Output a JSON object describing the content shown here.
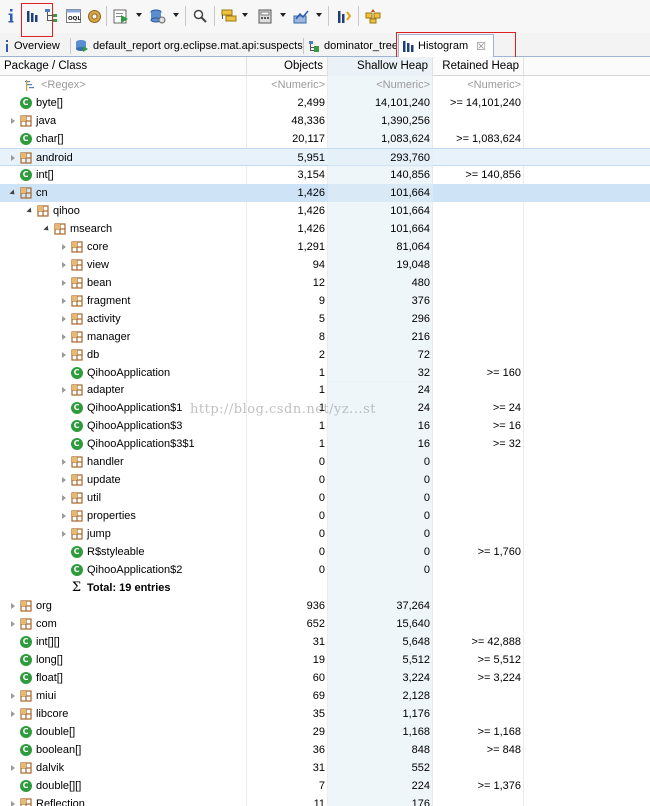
{
  "toolbar": {
    "icons": [
      "info-icon",
      "histogram-icon",
      "dominator-tree-icon",
      "oql-icon",
      "gear-icon",
      "run-report-icon",
      "query-browser-icon",
      "search-icon",
      "group-icon",
      "calculator-icon",
      "export-icon",
      "compare-icon",
      "heap-dump-overview-icon"
    ]
  },
  "tabs": [
    {
      "label": "Overview",
      "icon": "info-icon"
    },
    {
      "label": "default_report  org.eclipse.mat.api:suspects",
      "icon": "report-icon"
    },
    {
      "label": "dominator_tree",
      "icon": "dominator-tree-icon"
    },
    {
      "label": "Histogram",
      "icon": "histogram-icon",
      "active": true,
      "close": "☒"
    }
  ],
  "columns": {
    "name": "Package / Class",
    "objects": "Objects",
    "shallow": "Shallow Heap",
    "retained": "Retained Heap"
  },
  "filter": {
    "name": "<Regex>",
    "objects": "<Numeric>",
    "shallow": "<Numeric>",
    "retained": "<Numeric>"
  },
  "colors": {
    "class_icon": "#2e9b3c",
    "package_icon": "#b9762a",
    "selection": "#cfe3f7",
    "highlight_box": "#e02020"
  },
  "rows": [
    {
      "indent": 0,
      "arrow": "none",
      "icon": "class",
      "name": "byte[]",
      "objects": "2,499",
      "shallow": "14,101,240",
      "retained": ">= 14,101,240"
    },
    {
      "indent": 0,
      "arrow": "closed",
      "icon": "package",
      "name": "java",
      "objects": "48,336",
      "shallow": "1,390,256",
      "retained": ""
    },
    {
      "indent": 0,
      "arrow": "none",
      "icon": "class",
      "name": "char[]",
      "objects": "20,117",
      "shallow": "1,083,624",
      "retained": ">= 1,083,624"
    },
    {
      "indent": 0,
      "arrow": "closed",
      "icon": "package",
      "name": "android",
      "objects": "5,951",
      "shallow": "293,760",
      "retained": "",
      "state": "hover"
    },
    {
      "indent": 0,
      "arrow": "none",
      "icon": "class",
      "name": "int[]",
      "objects": "3,154",
      "shallow": "140,856",
      "retained": ">= 140,856"
    },
    {
      "indent": 0,
      "arrow": "open",
      "icon": "package",
      "name": "cn",
      "objects": "1,426",
      "shallow": "101,664",
      "retained": "",
      "state": "selected"
    },
    {
      "indent": 1,
      "arrow": "open",
      "icon": "package",
      "name": "qihoo",
      "objects": "1,426",
      "shallow": "101,664",
      "retained": ""
    },
    {
      "indent": 2,
      "arrow": "open",
      "icon": "package",
      "name": "msearch",
      "objects": "1,426",
      "shallow": "101,664",
      "retained": ""
    },
    {
      "indent": 3,
      "arrow": "closed",
      "icon": "package",
      "name": "core",
      "objects": "1,291",
      "shallow": "81,064",
      "retained": ""
    },
    {
      "indent": 3,
      "arrow": "closed",
      "icon": "package",
      "name": "view",
      "objects": "94",
      "shallow": "19,048",
      "retained": ""
    },
    {
      "indent": 3,
      "arrow": "closed",
      "icon": "package",
      "name": "bean",
      "objects": "12",
      "shallow": "480",
      "retained": ""
    },
    {
      "indent": 3,
      "arrow": "closed",
      "icon": "package",
      "name": "fragment",
      "objects": "9",
      "shallow": "376",
      "retained": ""
    },
    {
      "indent": 3,
      "arrow": "closed",
      "icon": "package",
      "name": "activity",
      "objects": "5",
      "shallow": "296",
      "retained": ""
    },
    {
      "indent": 3,
      "arrow": "closed",
      "icon": "package",
      "name": "manager",
      "objects": "8",
      "shallow": "216",
      "retained": ""
    },
    {
      "indent": 3,
      "arrow": "closed",
      "icon": "package",
      "name": "db",
      "objects": "2",
      "shallow": "72",
      "retained": ""
    },
    {
      "indent": 3,
      "arrow": "none",
      "icon": "class",
      "name": "QihooApplication",
      "objects": "1",
      "shallow": "32",
      "retained": ">= 160"
    },
    {
      "indent": 3,
      "arrow": "closed",
      "icon": "package",
      "name": "adapter",
      "objects": "1",
      "shallow": "24",
      "retained": ""
    },
    {
      "indent": 3,
      "arrow": "none",
      "icon": "class",
      "name": "QihooApplication$1",
      "objects": "1",
      "shallow": "24",
      "retained": ">= 24"
    },
    {
      "indent": 3,
      "arrow": "none",
      "icon": "class",
      "name": "QihooApplication$3",
      "objects": "1",
      "shallow": "16",
      "retained": ">= 16"
    },
    {
      "indent": 3,
      "arrow": "none",
      "icon": "class",
      "name": "QihooApplication$3$1",
      "objects": "1",
      "shallow": "16",
      "retained": ">= 32"
    },
    {
      "indent": 3,
      "arrow": "closed",
      "icon": "package",
      "name": "handler",
      "objects": "0",
      "shallow": "0",
      "retained": ""
    },
    {
      "indent": 3,
      "arrow": "closed",
      "icon": "package",
      "name": "update",
      "objects": "0",
      "shallow": "0",
      "retained": ""
    },
    {
      "indent": 3,
      "arrow": "closed",
      "icon": "package",
      "name": "util",
      "objects": "0",
      "shallow": "0",
      "retained": ""
    },
    {
      "indent": 3,
      "arrow": "closed",
      "icon": "package",
      "name": "properties",
      "objects": "0",
      "shallow": "0",
      "retained": ""
    },
    {
      "indent": 3,
      "arrow": "closed",
      "icon": "package",
      "name": "jump",
      "objects": "0",
      "shallow": "0",
      "retained": ""
    },
    {
      "indent": 3,
      "arrow": "none",
      "icon": "class",
      "name": "R$styleable",
      "objects": "0",
      "shallow": "0",
      "retained": ">= 1,760"
    },
    {
      "indent": 3,
      "arrow": "none",
      "icon": "class",
      "name": "QihooApplication$2",
      "objects": "0",
      "shallow": "0",
      "retained": ""
    },
    {
      "indent": 3,
      "arrow": "none",
      "icon": "sigma",
      "name": "Total: 19 entries",
      "objects": "",
      "shallow": "",
      "retained": "",
      "bold": true
    },
    {
      "indent": 0,
      "arrow": "closed",
      "icon": "package",
      "name": "org",
      "objects": "936",
      "shallow": "37,264",
      "retained": ""
    },
    {
      "indent": 0,
      "arrow": "closed",
      "icon": "package",
      "name": "com",
      "objects": "652",
      "shallow": "15,640",
      "retained": ""
    },
    {
      "indent": 0,
      "arrow": "none",
      "icon": "class",
      "name": "int[][]",
      "objects": "31",
      "shallow": "5,648",
      "retained": ">= 42,888"
    },
    {
      "indent": 0,
      "arrow": "none",
      "icon": "class",
      "name": "long[]",
      "objects": "19",
      "shallow": "5,512",
      "retained": ">= 5,512"
    },
    {
      "indent": 0,
      "arrow": "none",
      "icon": "class",
      "name": "float[]",
      "objects": "60",
      "shallow": "3,224",
      "retained": ">= 3,224"
    },
    {
      "indent": 0,
      "arrow": "closed",
      "icon": "package",
      "name": "miui",
      "objects": "69",
      "shallow": "2,128",
      "retained": ""
    },
    {
      "indent": 0,
      "arrow": "closed",
      "icon": "package",
      "name": "libcore",
      "objects": "35",
      "shallow": "1,176",
      "retained": ""
    },
    {
      "indent": 0,
      "arrow": "none",
      "icon": "class",
      "name": "double[]",
      "objects": "29",
      "shallow": "1,168",
      "retained": ">= 1,168"
    },
    {
      "indent": 0,
      "arrow": "none",
      "icon": "class",
      "name": "boolean[]",
      "objects": "36",
      "shallow": "848",
      "retained": ">= 848"
    },
    {
      "indent": 0,
      "arrow": "closed",
      "icon": "package",
      "name": "dalvik",
      "objects": "31",
      "shallow": "552",
      "retained": ""
    },
    {
      "indent": 0,
      "arrow": "none",
      "icon": "class",
      "name": "double[][]",
      "objects": "7",
      "shallow": "224",
      "retained": ">= 1,376"
    },
    {
      "indent": 0,
      "arrow": "closed",
      "icon": "package",
      "name": "Reflection",
      "objects": "11",
      "shallow": "176",
      "retained": ""
    }
  ],
  "watermark": "http://blog.csdn.net/yz...st"
}
